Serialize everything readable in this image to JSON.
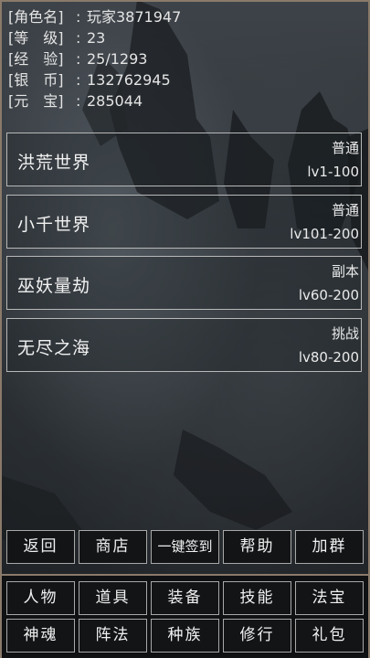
{
  "player": {
    "rows": [
      {
        "label": "[角色名]",
        "value": "玩家3871947"
      },
      {
        "label": "[等　级]",
        "value": "23"
      },
      {
        "label": "[经　验]",
        "value": "25/1293"
      },
      {
        "label": "[银　币]",
        "value": "132762945"
      },
      {
        "label": "[元　宝]",
        "value": "285044"
      }
    ],
    "colon": ":"
  },
  "worlds": [
    {
      "name": "洪荒世界",
      "type": "普通",
      "level": "lv1-100"
    },
    {
      "name": "小千世界",
      "type": "普通",
      "level": "lv101-200"
    },
    {
      "name": "巫妖量劫",
      "type": "副本",
      "level": "lv60-200"
    },
    {
      "name": "无尽之海",
      "type": "挑战",
      "level": "lv80-200"
    }
  ],
  "action_bar": {
    "back": "返回",
    "shop": "商店",
    "checkin": "一键签到",
    "help": "帮助",
    "join_group": "加群"
  },
  "nav": {
    "character": "人物",
    "items": "道具",
    "equipment": "装备",
    "skills": "技能",
    "treasure": "法宝",
    "soul": "神魂",
    "formation": "阵法",
    "race": "种族",
    "cultivation": "修行",
    "gift": "礼包"
  }
}
